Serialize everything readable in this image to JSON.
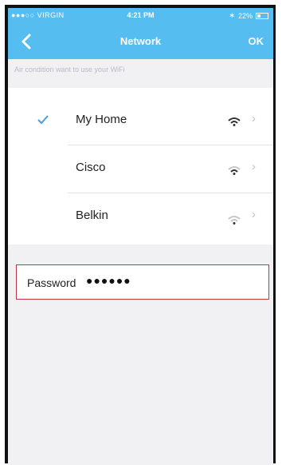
{
  "status_bar": {
    "carrier": "●●●○○ VIRGIN",
    "time": "4:21 PM",
    "battery": "22%"
  },
  "nav": {
    "title": "Network",
    "ok_label": "OK",
    "back_icon": "chevron-left-icon"
  },
  "hint": "Air condition want to use your WiFi",
  "networks": [
    {
      "name": "My Home",
      "selected": true,
      "signal": "strong"
    },
    {
      "name": "Cisco",
      "selected": false,
      "signal": "medium"
    },
    {
      "name": "Belkin",
      "selected": false,
      "signal": "weak"
    }
  ],
  "password": {
    "label": "Password",
    "value": "●●●●●●"
  },
  "colors": {
    "accent": "#55bdf0",
    "highlight_border": "#c63340",
    "background": "#f1f1f3"
  }
}
